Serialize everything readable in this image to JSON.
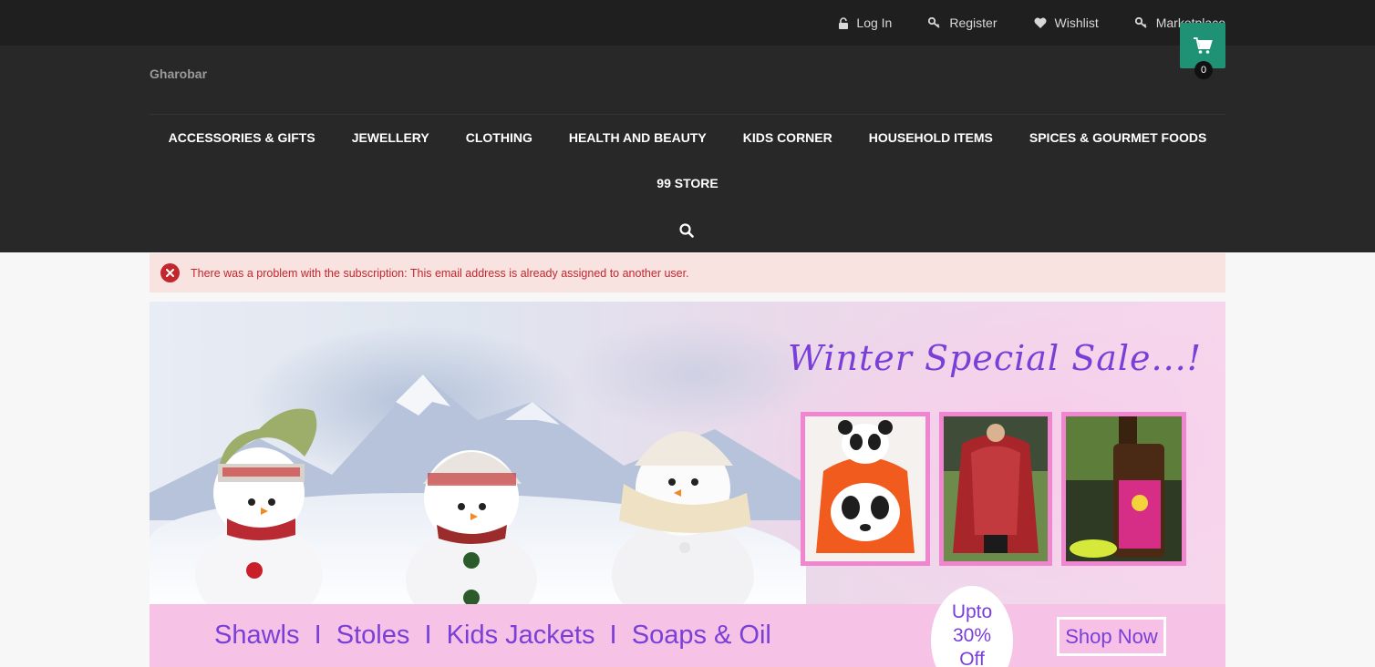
{
  "topbar": {
    "links": [
      {
        "label": "Log In",
        "icon": "lock-icon"
      },
      {
        "label": "Register",
        "icon": "key-icon"
      },
      {
        "label": "Wishlist",
        "icon": "heart-icon"
      },
      {
        "label": "Marketplace",
        "icon": "key-icon"
      }
    ]
  },
  "header": {
    "logo": "Gharobar",
    "cart_count": "0",
    "nav_row1": [
      "ACCESSORIES & GIFTS",
      "JEWELLERY",
      "CLOTHING",
      "HEALTH AND BEAUTY",
      "KIDS CORNER",
      "HOUSEHOLD ITEMS",
      "SPICES & GOURMET FOODS"
    ],
    "nav_row2": [
      "99 STORE"
    ]
  },
  "alert": {
    "message": "There was a problem with the subscription: This email address is already assigned to another user."
  },
  "banner": {
    "title": "Winter Special Sale...!",
    "categories": "Shawls  I  Stoles  I  Kids Jackets  I  Soaps & Oil",
    "upto": [
      "Upto",
      "30%",
      "Off"
    ],
    "cta": "Shop Now"
  },
  "colors": {
    "topbar_bg": "#1f1f1f",
    "header_bg": "#282828",
    "cart_accent": "#1f9276",
    "error_bg": "#f9e3e1",
    "error_text": "#c1272d",
    "banner_purple": "#7a3fd6",
    "banner_pink": "#f6c3e6"
  }
}
